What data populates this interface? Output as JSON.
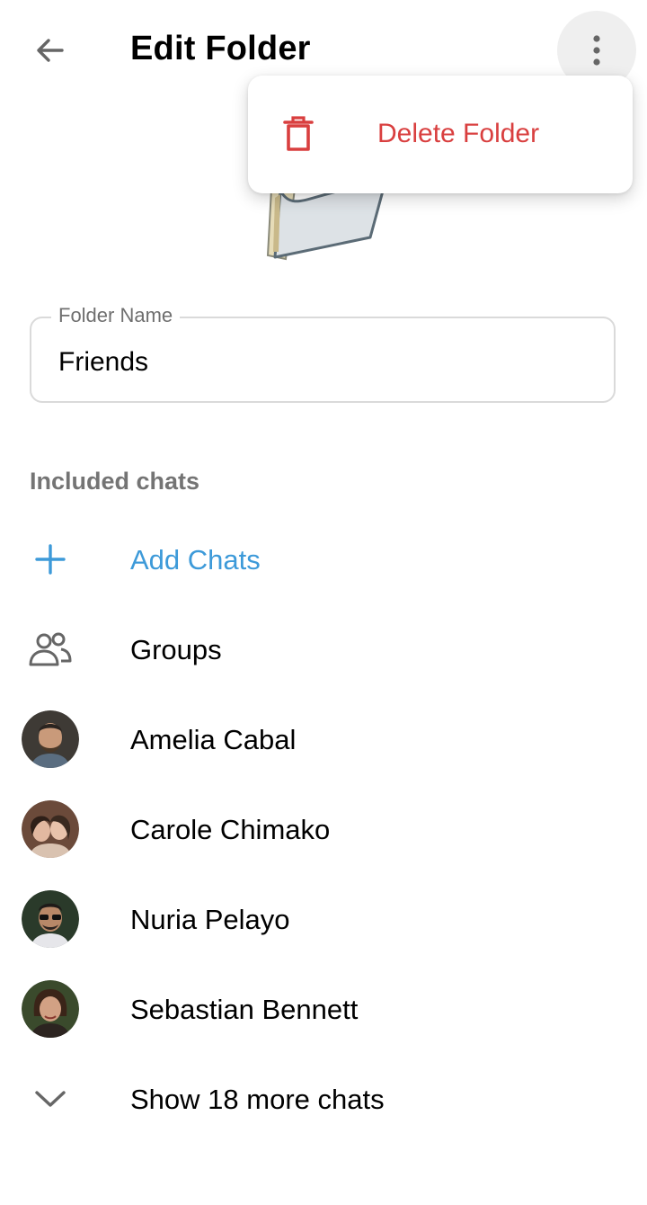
{
  "header": {
    "title": "Edit Folder",
    "back_icon": "arrow-left-icon",
    "more_icon": "more-vert-icon"
  },
  "menu": {
    "delete_label": "Delete Folder",
    "delete_icon": "trash-icon",
    "accent": "#d93f3f"
  },
  "folder_name": {
    "label": "Folder Name",
    "value": "Friends"
  },
  "included": {
    "title": "Included chats",
    "add_label": "Add Chats",
    "accent": "#3d9ad9",
    "groups_label": "Groups",
    "chats": [
      {
        "name": "Amelia Cabal"
      },
      {
        "name": "Carole Chimako"
      },
      {
        "name": "Nuria Pelayo"
      },
      {
        "name": "Sebastian Bennett"
      }
    ],
    "more_label": "Show 18 more chats"
  }
}
